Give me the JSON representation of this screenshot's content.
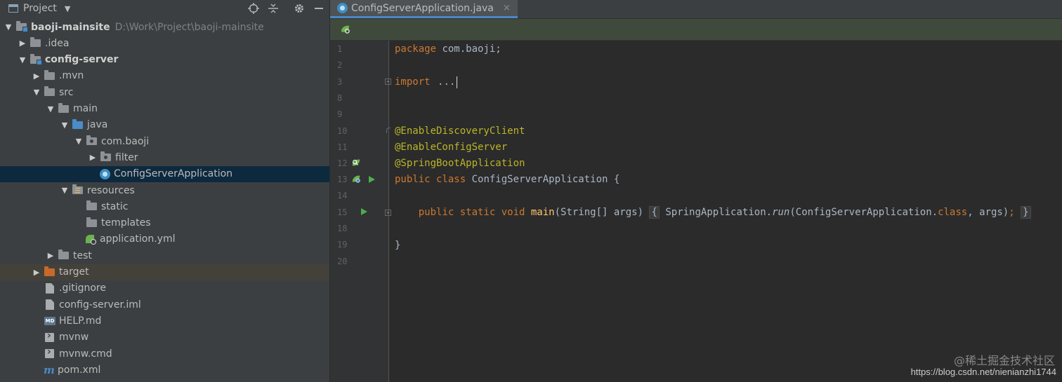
{
  "project_panel": {
    "title": "Project",
    "toolbar_icons": [
      "locate-icon",
      "collapse-all-icon",
      "gear-icon",
      "hide-icon"
    ],
    "tree": [
      {
        "label": "baoji-mainsite",
        "path": "D:\\Work\\Project\\baoji-mainsite",
        "depth": 0,
        "expanded": true,
        "icon": "module-folder",
        "bold": true
      },
      {
        "label": ".idea",
        "depth": 1,
        "expanded": false,
        "icon": "folder"
      },
      {
        "label": "config-server",
        "depth": 1,
        "expanded": true,
        "icon": "module-folder",
        "bold": true
      },
      {
        "label": ".mvn",
        "depth": 2,
        "expanded": false,
        "icon": "folder"
      },
      {
        "label": "src",
        "depth": 2,
        "expanded": true,
        "icon": "folder"
      },
      {
        "label": "main",
        "depth": 3,
        "expanded": true,
        "icon": "folder"
      },
      {
        "label": "java",
        "depth": 4,
        "expanded": true,
        "icon": "source-folder"
      },
      {
        "label": "com.baoji",
        "depth": 5,
        "expanded": true,
        "icon": "package"
      },
      {
        "label": "filter",
        "depth": 6,
        "expanded": false,
        "icon": "package"
      },
      {
        "label": "ConfigServerApplication",
        "depth": 6,
        "icon": "class",
        "selected": true
      },
      {
        "label": "resources",
        "depth": 4,
        "expanded": true,
        "icon": "resources-folder"
      },
      {
        "label": "static",
        "depth": 5,
        "icon": "folder"
      },
      {
        "label": "templates",
        "depth": 5,
        "icon": "folder"
      },
      {
        "label": "application.yml",
        "depth": 5,
        "icon": "yml"
      },
      {
        "label": "test",
        "depth": 3,
        "expanded": false,
        "icon": "folder"
      },
      {
        "label": "target",
        "depth": 2,
        "expanded": false,
        "icon": "excluded-folder",
        "excluded": true
      },
      {
        "label": ".gitignore",
        "depth": 2,
        "icon": "file"
      },
      {
        "label": "config-server.iml",
        "depth": 2,
        "icon": "file"
      },
      {
        "label": "HELP.md",
        "depth": 2,
        "icon": "md"
      },
      {
        "label": "mvnw",
        "depth": 2,
        "icon": "script"
      },
      {
        "label": "mvnw.cmd",
        "depth": 2,
        "icon": "script"
      },
      {
        "label": "pom.xml",
        "depth": 2,
        "icon": "maven"
      }
    ]
  },
  "editor": {
    "tab": {
      "label": "ConfigServerApplication.java",
      "close": "×"
    },
    "line_numbers": [
      "1",
      "2",
      "3",
      "8",
      "9",
      "10",
      "11",
      "12",
      "13",
      "14",
      "15",
      "18",
      "19",
      "20"
    ],
    "code": {
      "l1_kw": "package",
      "l1_rest": " com.baoji;",
      "l3_kw": "import",
      "l3_fold": "...",
      "l10": "@EnableDiscoveryClient",
      "l11": "@EnableConfigServer",
      "l12": "@SpringBootApplication",
      "l13_kw": "public class",
      "l13_rest": " ConfigServerApplication {",
      "l15_kw": "public static void",
      "l15_fn": "main",
      "l15_args": "(String[] args)",
      "l15_open": "{",
      "l15_body1": " SpringApplication.",
      "l15_run": "run",
      "l15_body2": "(ConfigServerApplication.",
      "l15_class": "class",
      "l15_body3": ", args)",
      "l15_semi": ";",
      "l15_close": "}",
      "l19": "}"
    }
  },
  "watermark": {
    "line1": "@稀土掘金技术社区",
    "line2": "https://blog.csdn.net/nienianzhi1744"
  }
}
